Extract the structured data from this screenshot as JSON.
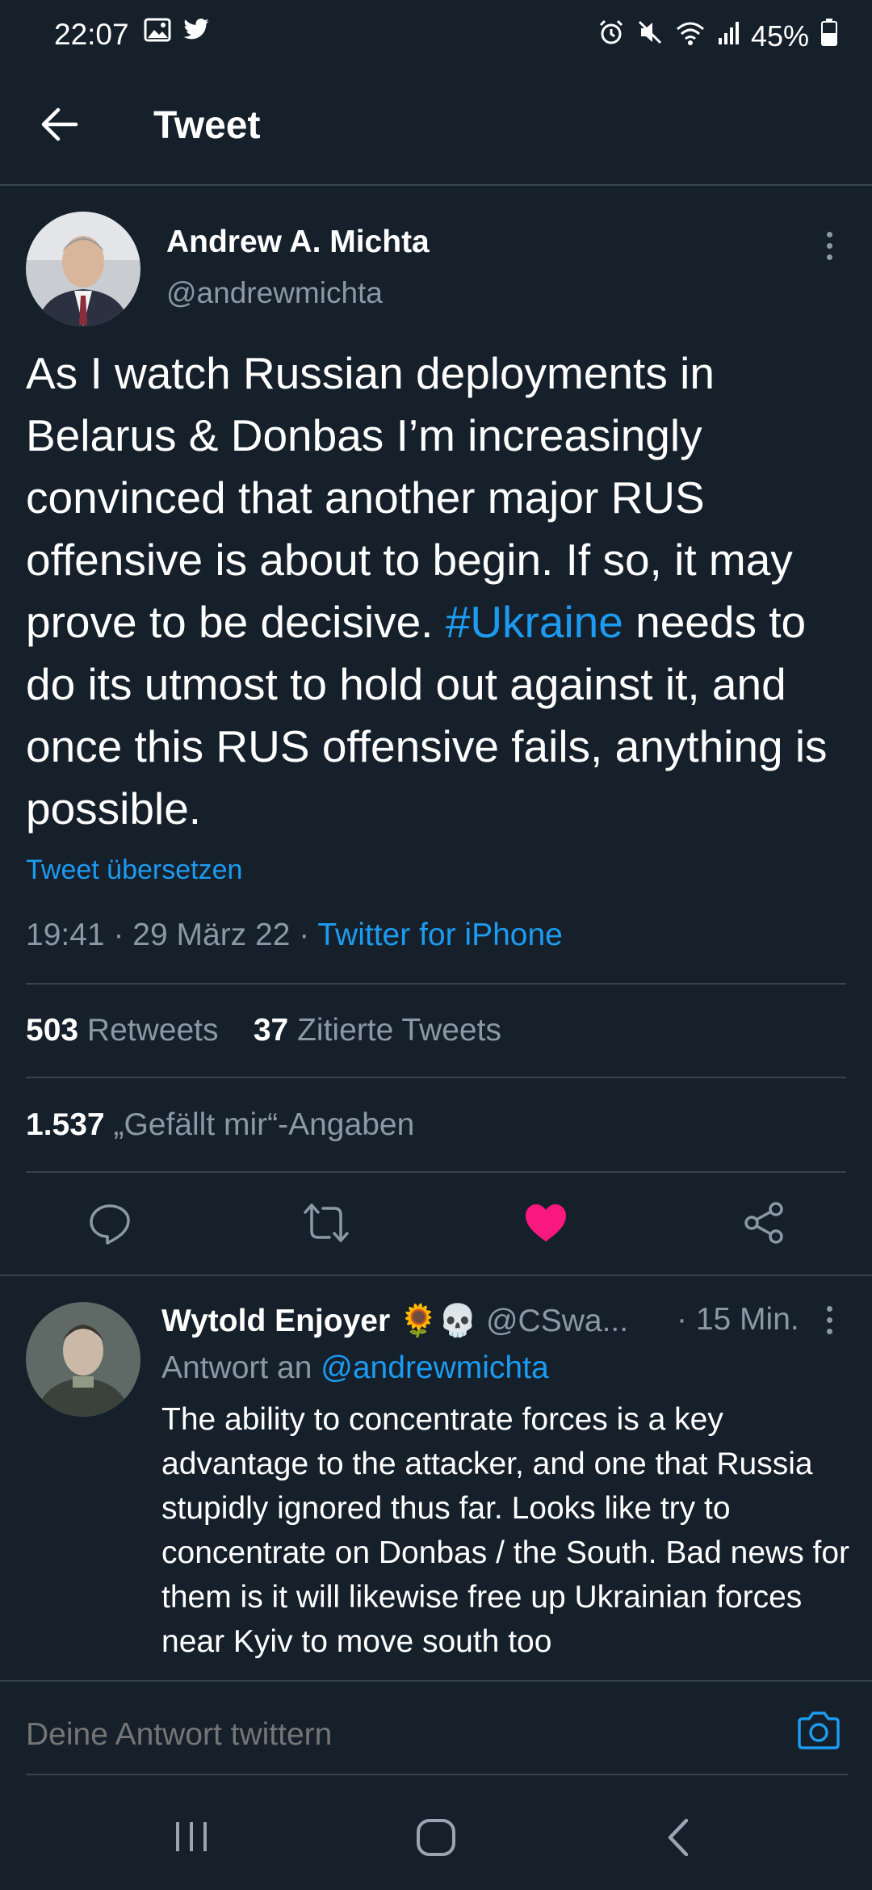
{
  "status_bar": {
    "time": "22:07",
    "battery": "45%",
    "icons": [
      "image-icon",
      "twitter-icon",
      "alarm-icon",
      "mute-icon",
      "wifi-icon",
      "signal-icon",
      "battery-icon"
    ]
  },
  "header": {
    "title": "Tweet"
  },
  "tweet": {
    "author_name": "Andrew A. Michta",
    "author_handle": "@andrewmichta",
    "text_before": "As I watch Russian deployments in Belarus & Donbas I’m increasingly convinced that another major RUS offensive is about to begin. If so, it may prove to be decisive. ",
    "hashtag": "#Ukraine",
    "text_after": " needs to do its utmost to hold out against it,  and once this RUS offensive fails, anything is possible.",
    "translate_label": "Tweet übersetzen",
    "time": "19:41",
    "date": "29 März 22",
    "separator": "·",
    "source": "Twitter for iPhone",
    "retweets_count": "503",
    "retweets_label": "Retweets",
    "quotes_count": "37",
    "quotes_label": "Zitierte Tweets",
    "likes_count": "1.537",
    "likes_label": "„Gefällt mir“-Angaben",
    "like_color": "#f91880",
    "accent_color": "#1d9bf0"
  },
  "reply": {
    "name": "Wytold Enjoyer 🌻💀",
    "handle": "@CSwa...",
    "time": "· 15 Min.",
    "reply_to_label": "Antwort an",
    "reply_to_handle": "@andrewmichta",
    "text": "The ability to concentrate forces is a key advantage to the attacker, and one that Russia stupidly ignored thus far. Looks like try to concentrate on Donbas / the South. Bad news for them is it will likewise free up Ukrainian forces near Kyiv to move south too"
  },
  "compose": {
    "placeholder": "Deine Antwort twittern"
  }
}
